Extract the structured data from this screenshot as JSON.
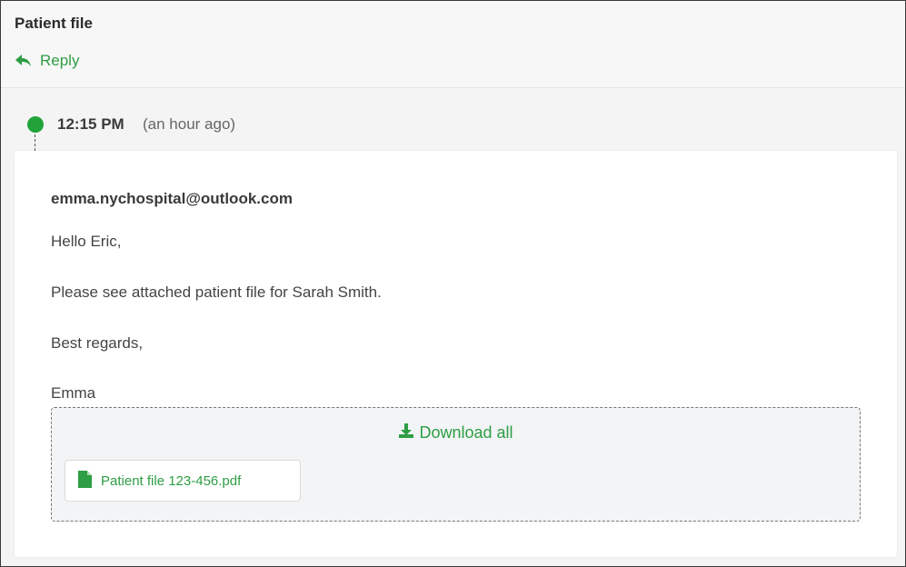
{
  "header": {
    "title": "Patient file",
    "reply_label": "Reply"
  },
  "message": {
    "time": "12:15 PM",
    "relative_time": "(an hour ago)",
    "sender": "emma.nychospital@outlook.com",
    "body": [
      "Hello Eric,",
      "Please see attached patient file for Sarah Smith.",
      "Best regards,",
      "Emma"
    ]
  },
  "attachments": {
    "download_all_label": "Download all",
    "files": [
      {
        "name": "Patient file 123-456.pdf",
        "icon": "file-icon"
      }
    ]
  },
  "colors": {
    "accent": "#2e9e44",
    "timeline_dot": "#22a33a"
  }
}
